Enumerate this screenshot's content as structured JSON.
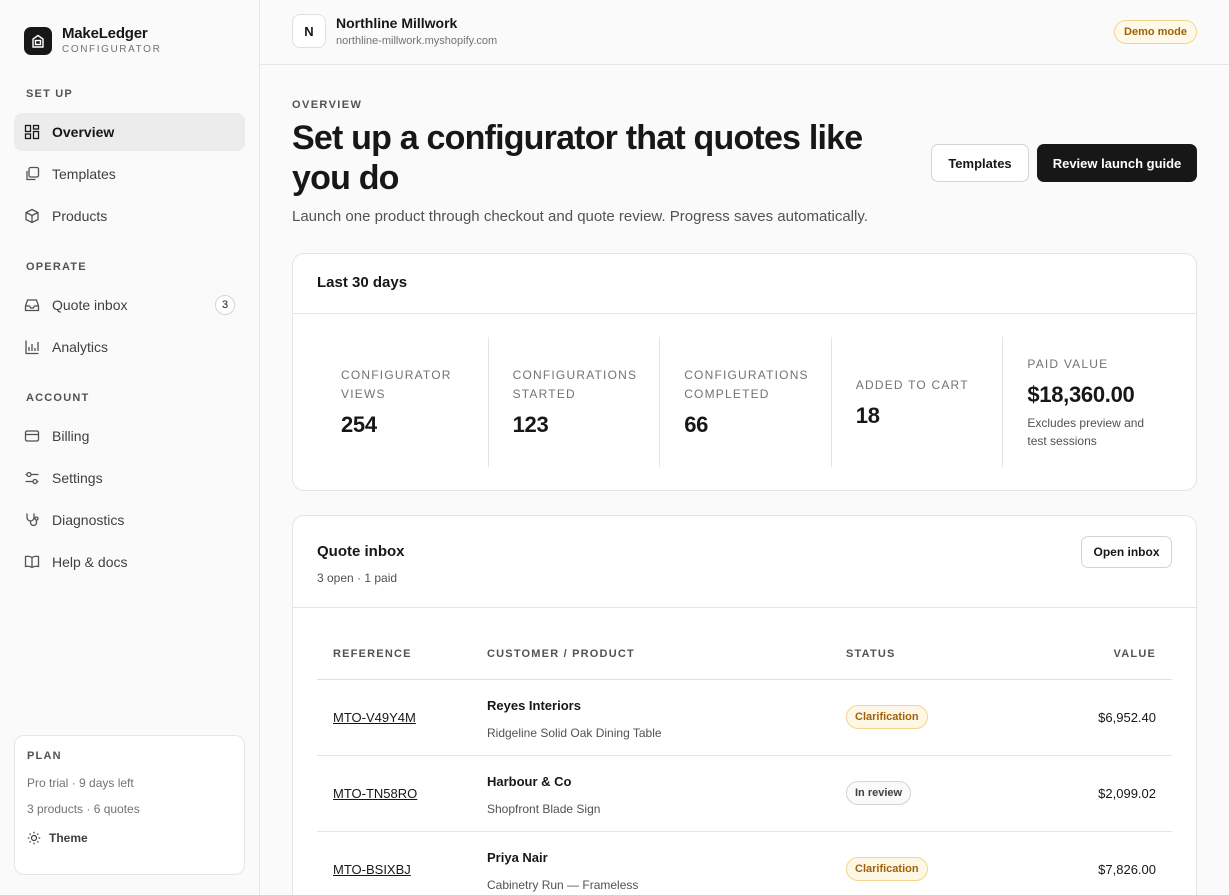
{
  "brand": {
    "name": "MakeLedger",
    "sub": "CONFIGURATOR"
  },
  "sidebar": {
    "setup_label": "SET UP",
    "setup": [
      {
        "label": "Overview",
        "icon": "overview-icon",
        "active": true
      },
      {
        "label": "Templates",
        "icon": "templates-icon"
      },
      {
        "label": "Products",
        "icon": "products-icon"
      }
    ],
    "operate_label": "OPERATE",
    "operate": [
      {
        "label": "Quote inbox",
        "icon": "inbox-icon",
        "badge": "3"
      },
      {
        "label": "Analytics",
        "icon": "analytics-icon"
      }
    ],
    "account_label": "ACCOUNT",
    "account": [
      {
        "label": "Billing",
        "icon": "billing-icon"
      },
      {
        "label": "Settings",
        "icon": "settings-icon"
      },
      {
        "label": "Diagnostics",
        "icon": "diagnostics-icon"
      },
      {
        "label": "Help & docs",
        "icon": "help-icon"
      }
    ]
  },
  "plan": {
    "title": "PLAN",
    "trial": "Pro trial · 9 days left",
    "usage": "3 products · 6 quotes",
    "theme_label": "Theme"
  },
  "topbar": {
    "avatar": "N",
    "store_name": "Northline Millwork",
    "store_domain": "northline-millwork.myshopify.com",
    "demo_badge": "Demo mode"
  },
  "header": {
    "eyebrow": "OVERVIEW",
    "title": "Set up a configurator that quotes like you do",
    "subtitle": "Launch one product through checkout and quote review. Progress saves automatically.",
    "templates_button": "Templates",
    "launch_button": "Review launch guide"
  },
  "stats": {
    "title": "Last 30 days",
    "items": [
      {
        "label": "CONFIGURATOR VIEWS",
        "value": "254"
      },
      {
        "label": "CONFIGURATIONS STARTED",
        "value": "123"
      },
      {
        "label": "CONFIGURATIONS COMPLETED",
        "value": "66"
      },
      {
        "label": "ADDED TO CART",
        "value": "18"
      },
      {
        "label": "PAID VALUE",
        "value": "$18,360.00",
        "note": "Excludes preview and test sessions"
      }
    ]
  },
  "inbox": {
    "title": "Quote inbox",
    "subtitle": "3 open · 1 paid",
    "open_button": "Open inbox",
    "columns": {
      "reference": "REFERENCE",
      "customer": "CUSTOMER / PRODUCT",
      "status": "STATUS",
      "value": "VALUE"
    },
    "rows": [
      {
        "ref": "MTO-V49Y4M",
        "customer": "Reyes Interiors",
        "product": "Ridgeline Solid Oak Dining Table",
        "status": "Clarification",
        "value": "$6,952.40"
      },
      {
        "ref": "MTO-TN58RO",
        "customer": "Harbour & Co",
        "product": "Shopfront Blade Sign",
        "status": "In review",
        "value": "$2,099.02"
      },
      {
        "ref": "MTO-BSIXBJ",
        "customer": "Priya Nair",
        "product": "Cabinetry Run — Frameless",
        "status": "Clarification",
        "value": "$7,826.00"
      }
    ]
  },
  "colors": {
    "accent": "#171717",
    "warning_bg": "#fef7e6",
    "warning_text": "#a16207"
  }
}
